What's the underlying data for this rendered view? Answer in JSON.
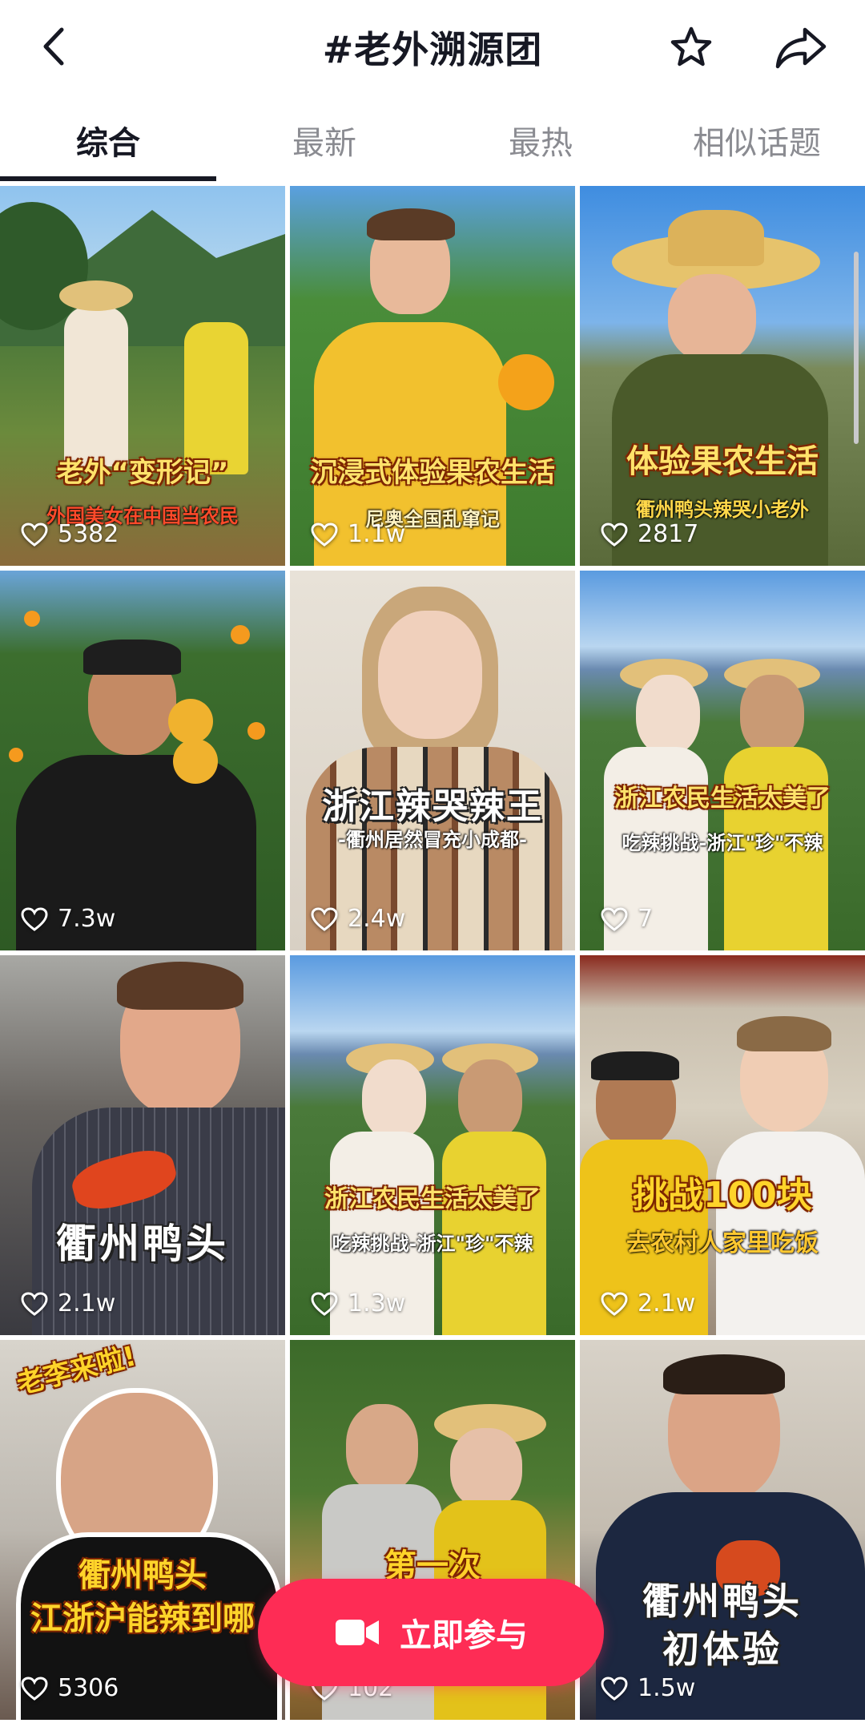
{
  "header": {
    "title": "#老外溯源团",
    "back_icon": "chevron-left-icon",
    "favorite_icon": "star-icon",
    "share_icon": "share-arrow-icon"
  },
  "tabs": [
    {
      "label": "综合",
      "active": true
    },
    {
      "label": "最新",
      "active": false
    },
    {
      "label": "最热",
      "active": false
    },
    {
      "label": "相似话题",
      "active": false
    }
  ],
  "videos": [
    {
      "caption": "老外“变形记”",
      "subcaption": "外国美女在中国当农民",
      "likes": "5382"
    },
    {
      "caption": "沉浸式体验果农生活",
      "subcaption": "尼奥全国乱窜记",
      "likes": "1.1w"
    },
    {
      "caption": "体验果农生活",
      "subcaption": "衢州鸭头辣哭小老外",
      "likes": "2817"
    },
    {
      "caption": "",
      "subcaption": "",
      "likes": "7.3w"
    },
    {
      "caption": "浙江辣哭辣王",
      "subcaption": "-衢州居然冒充小成都-",
      "likes": "2.4w"
    },
    {
      "caption": "浙江农民生活太美了",
      "subcaption": "吃辣挑战-浙江\"珍\"不辣",
      "likes": "7"
    },
    {
      "caption": "衢州鸭头",
      "subcaption": "",
      "likes": "2.1w"
    },
    {
      "caption": "浙江农民生活太美了",
      "subcaption": "吃辣挑战-浙江\"珍\"不辣",
      "likes": "1.3w"
    },
    {
      "caption": "挑战100块",
      "subcaption": "去农村人家里吃饭",
      "likes": "2.1w"
    },
    {
      "caption": "衢州鸭头",
      "subcaption": "江浙沪能辣到哪",
      "tag": "老李来啦!",
      "likes": "5306"
    },
    {
      "caption": "第一次",
      "subcaption": "",
      "likes": "102"
    },
    {
      "caption": "衢州鸭头",
      "subcaption": "初体验",
      "likes": "1.5w"
    }
  ],
  "join_button": {
    "label": "立即参与",
    "icon": "video-camera-icon",
    "color": "#fe2c55"
  }
}
